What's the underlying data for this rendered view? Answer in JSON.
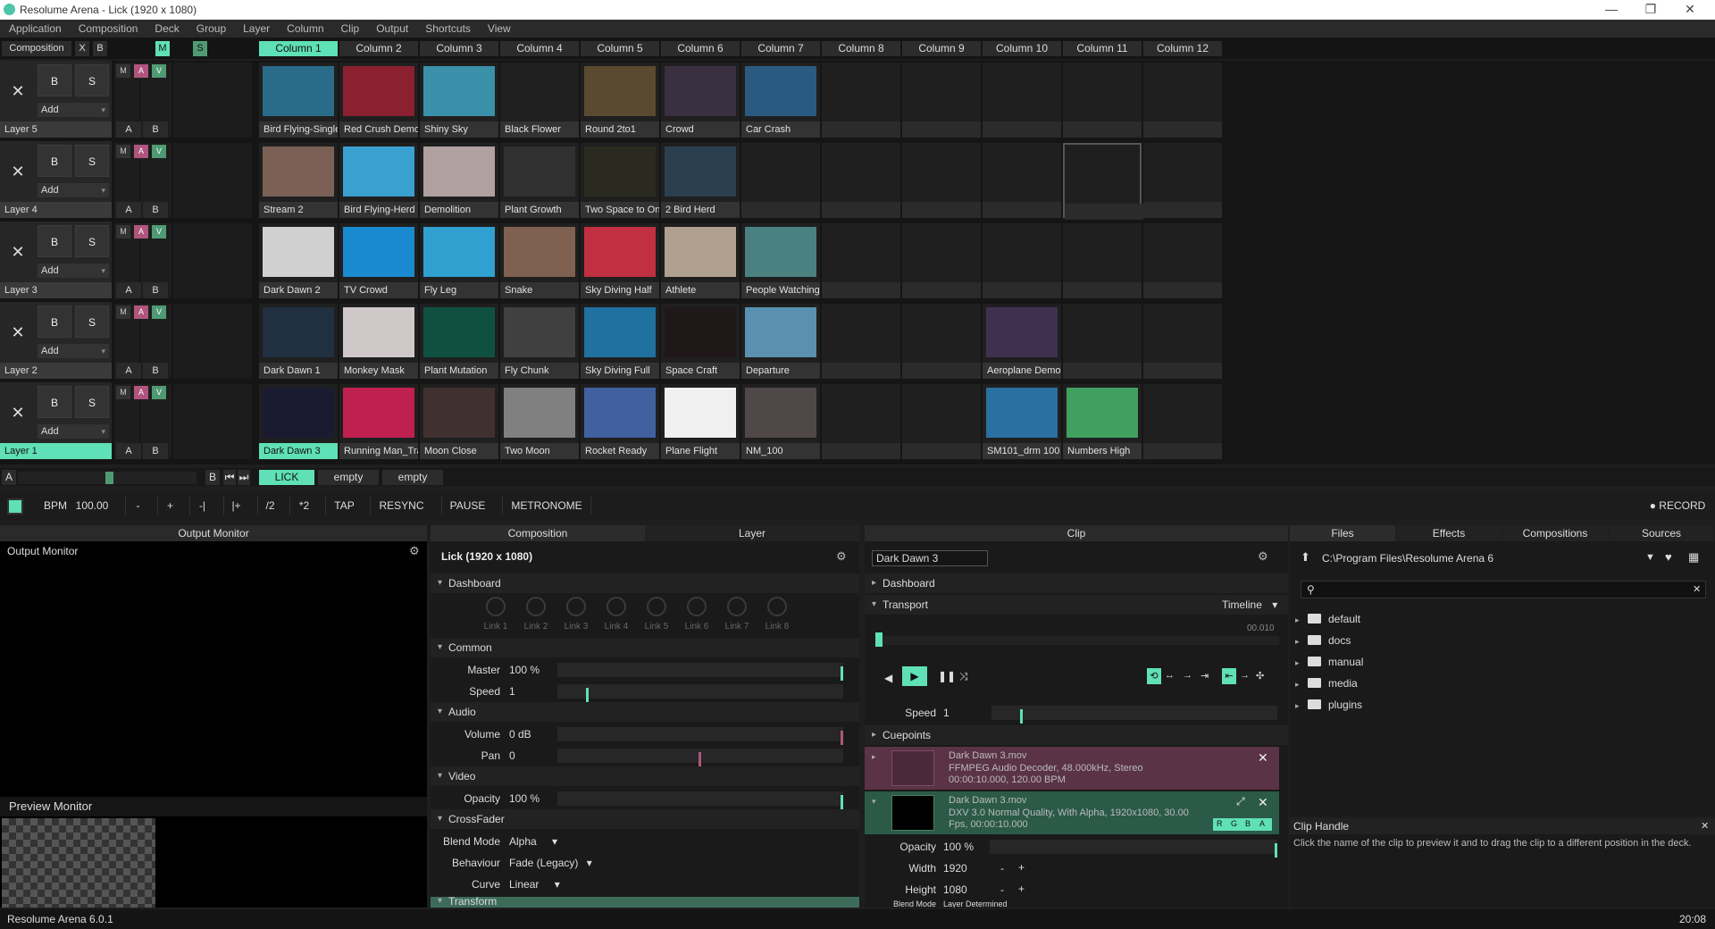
{
  "window": {
    "title": "Resolume Arena - Lick (1920 x 1080)"
  },
  "menu": [
    "Application",
    "Composition",
    "Deck",
    "Group",
    "Layer",
    "Column",
    "Clip",
    "Output",
    "Shortcuts",
    "View"
  ],
  "composition": {
    "label": "Composition",
    "x": "X",
    "b": "B",
    "m": "M",
    "s": "S"
  },
  "columns": [
    "Column 1",
    "Column 2",
    "Column 3",
    "Column 4",
    "Column 5",
    "Column 6",
    "Column 7",
    "Column 8",
    "Column 9",
    "Column 10",
    "Column 11",
    "Column 12"
  ],
  "layers": [
    {
      "name": "Layer 5",
      "clips": [
        "Bird Flying-Single",
        "Red Crush Demo",
        "Shiny Sky",
        "Black Flower",
        "Round 2to1",
        "Crowd",
        "Car Crash",
        "",
        "",
        "",
        "",
        ""
      ]
    },
    {
      "name": "Layer 4",
      "clips": [
        "Stream 2",
        "Bird Flying-Herd",
        "Demolition",
        "Plant Growth",
        "Two Space to One",
        "2 Bird Herd",
        "",
        "",
        "",
        "",
        "",
        ""
      ]
    },
    {
      "name": "Layer 3",
      "clips": [
        "Dark Dawn 2",
        "TV Crowd",
        "Fly Leg",
        "Snake",
        "Sky Diving Half",
        "Athlete",
        "People Watching",
        "",
        "",
        "",
        "",
        ""
      ]
    },
    {
      "name": "Layer 2",
      "clips": [
        "Dark Dawn 1",
        "Monkey Mask",
        "Plant Mutation",
        "Fly Chunk",
        "Sky Diving Full",
        "Space Craft",
        "Departure",
        "",
        "",
        "Aeroplane Demo",
        "",
        ""
      ]
    },
    {
      "name": "Layer 1",
      "clips": [
        "Dark Dawn 3",
        "Running Man_Track",
        "Moon Close",
        "Two Moon",
        "Rocket Ready",
        "Plane Flight",
        "NM_100",
        "",
        "",
        "SM101_drm 100",
        "Numbers High",
        ""
      ]
    }
  ],
  "layer_ctrl": {
    "b": "B",
    "s": "S",
    "x": "✕",
    "add": "Add",
    "m": "M",
    "a": "A",
    "v": "V",
    "ab_a": "A",
    "ab_b": "B"
  },
  "deck": {
    "a": "A",
    "b": "B",
    "tabs": [
      "LICK",
      "empty",
      "empty"
    ]
  },
  "bpm": {
    "label": "BPM",
    "value": "100.00",
    "minus": "-",
    "plus": "+",
    "nudge_minus": "-|",
    "nudge_plus": "|+",
    "half": "/2",
    "double": "*2",
    "tap": "TAP",
    "resync": "RESYNC",
    "pause": "PAUSE",
    "metronome": "METRONOME",
    "record": "RECORD"
  },
  "output": {
    "header": "Output Monitor",
    "title": "Output Monitor",
    "preview": "Preview Monitor"
  },
  "comp": {
    "tab_comp": "Composition",
    "tab_layer": "Layer",
    "title": "Lick (1920 x 1080)",
    "dashboard": "Dashboard",
    "links": [
      "Link 1",
      "Link 2",
      "Link 3",
      "Link 4",
      "Link 5",
      "Link 6",
      "Link 7",
      "Link 8"
    ],
    "common": "Common",
    "master_k": "Master",
    "master_v": "100 %",
    "speed_k": "Speed",
    "speed_v": "1",
    "audio": "Audio",
    "volume_k": "Volume",
    "volume_v": "0 dB",
    "pan_k": "Pan",
    "pan_v": "0",
    "video": "Video",
    "opacity_k": "Opacity",
    "opacity_v": "100 %",
    "crossfader": "CrossFader",
    "blend_k": "Blend Mode",
    "blend_v": "Alpha",
    "behav_k": "Behaviour",
    "behav_v": "Fade (Legacy)",
    "curve_k": "Curve",
    "curve_v": "Linear",
    "transform": "Transform"
  },
  "clip": {
    "header": "Clip",
    "name": "Dark Dawn 3",
    "dashboard": "Dashboard",
    "transport": "Transport",
    "timeline": "Timeline",
    "time": "00.010",
    "speed_k": "Speed",
    "speed_v": "1",
    "cuepoints": "Cuepoints",
    "audio_title": "Dark Dawn 3.mov",
    "audio_info1": "FFMPEG Audio Decoder, 48.000kHz, Stereo",
    "audio_info2": "00:00:10.000, 120.00 BPM",
    "video_title": "Dark Dawn 3.mov",
    "video_info1": "DXV 3.0 Normal Quality, With Alpha, 1920x1080, 30.00",
    "video_info2": "Fps, 00:00:10.000",
    "rgba": [
      "R",
      "G",
      "B",
      "A"
    ],
    "opacity_k": "Opacity",
    "opacity_v": "100 %",
    "width_k": "Width",
    "width_v": "1920",
    "height_k": "Height",
    "height_v": "1080",
    "blend_k": "Blend Mode",
    "blend_v": "Layer Determined"
  },
  "browser": {
    "tabs": [
      "Files",
      "Effects",
      "Compositions",
      "Sources"
    ],
    "path": "C:\\Program Files\\Resolume Arena 6",
    "search_placeholder": "",
    "folders": [
      "default",
      "docs",
      "manual",
      "media",
      "plugins"
    ]
  },
  "help": {
    "title": "Clip Handle",
    "text": "Click the name of the clip to preview it and to drag the clip to a different position in the deck."
  },
  "status": {
    "version": "Resolume Arena 6.0.1",
    "time": "20:08"
  },
  "colors": {
    "accent": "#5fe0b6",
    "audio": "#b0557d",
    "video": "#4f9a72"
  }
}
